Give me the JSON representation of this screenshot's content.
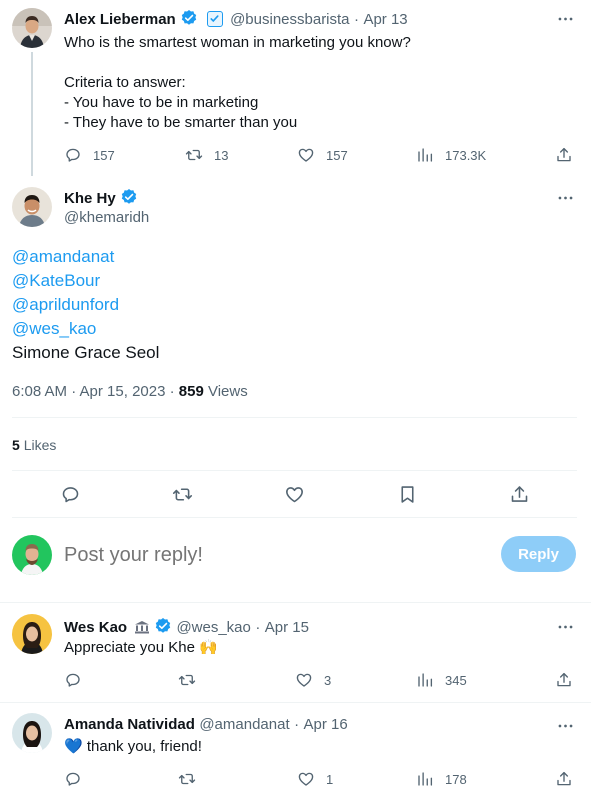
{
  "parent_tweet": {
    "name": "Alex Lieberman",
    "handle": "@businessbarista",
    "sep": "·",
    "date": "Apr 13",
    "text": "Who is the smartest woman in marketing you know?\n\nCriteria to answer:\n- You have to be in marketing\n- They have to be smarter than you",
    "replies": "157",
    "retweets": "13",
    "likes": "157",
    "views": "173.3K"
  },
  "main_tweet": {
    "name": "Khe Hy",
    "handle": "@khemaridh",
    "mentions": [
      "@amandanat",
      "@KateBour",
      "@aprildunford",
      "@wes_kao"
    ],
    "last_line": "Simone Grace Seol",
    "time": "6:08 AM · Apr 15, 2023 ·",
    "views_count": "859",
    "views_label": "Views",
    "likes_count": "5",
    "likes_label": "Likes"
  },
  "reply_box": {
    "placeholder": "Post your reply!",
    "button_label": "Reply"
  },
  "replies": [
    {
      "name": "Wes Kao",
      "badge_icon": "bank-icon",
      "handle": "@wes_kao",
      "sep": "·",
      "date": "Apr 15",
      "text": "Appreciate you Khe 🙌",
      "replies": "",
      "retweets": "",
      "likes": "3",
      "views": "345"
    },
    {
      "name": "Amanda Natividad",
      "handle": "@amandanat",
      "sep": "·",
      "date": "Apr 16",
      "text": "💙 thank you, friend!",
      "replies": "",
      "retweets": "",
      "likes": "1",
      "views": "178"
    }
  ],
  "colors": {
    "accent": "#1d9bf0",
    "reply_button_disabled": "#8ecdf8",
    "secondary_text": "#536471",
    "divider": "#eff3f4"
  }
}
